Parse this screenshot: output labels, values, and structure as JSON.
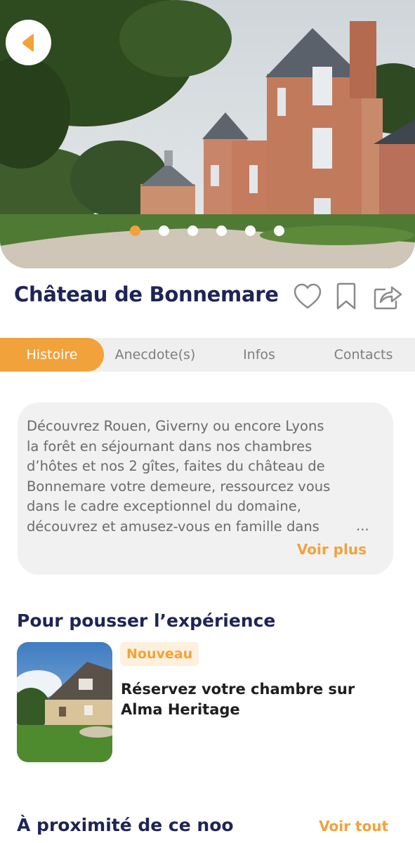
{
  "hero": {
    "slide_count": 6,
    "active_slide": 1,
    "colors": {
      "active_dot": "#f2a23a",
      "dot": "#ffffff"
    }
  },
  "header": {
    "title": "Château de Bonnemare",
    "icons": [
      "heart-icon",
      "bookmark-icon",
      "share-icon"
    ]
  },
  "tabs": [
    {
      "label": "Histoire",
      "active": true
    },
    {
      "label": "Anecdote(s)",
      "active": false
    },
    {
      "label": "Infos",
      "active": false
    },
    {
      "label": "Contacts",
      "active": false
    }
  ],
  "description": {
    "lines": [
      "Découvrez Rouen, Giverny ou encore Lyons",
      "la forêt en séjournant dans nos chambres",
      "d’hôtes et nos 2 gîtes, faites du château de",
      "Bonnemare votre demeure, ressourcez vous",
      "dans le cadre exceptionnel du domaine,",
      "découvrez et amusez-vous en famille dans"
    ],
    "ellipsis": "...",
    "more_label": "Voir plus"
  },
  "experience": {
    "title": "Pour pousser l’expérience",
    "badge": "Nouveau",
    "text": "Réservez votre chambre sur Alma Heritage"
  },
  "nearby": {
    "title": "À proximité de ce noo",
    "link": "Voir tout"
  },
  "colors": {
    "accent": "#f2a23a",
    "navy": "#1f2456",
    "card_bg": "#f1f1f1",
    "tab_bg": "#efefef"
  }
}
